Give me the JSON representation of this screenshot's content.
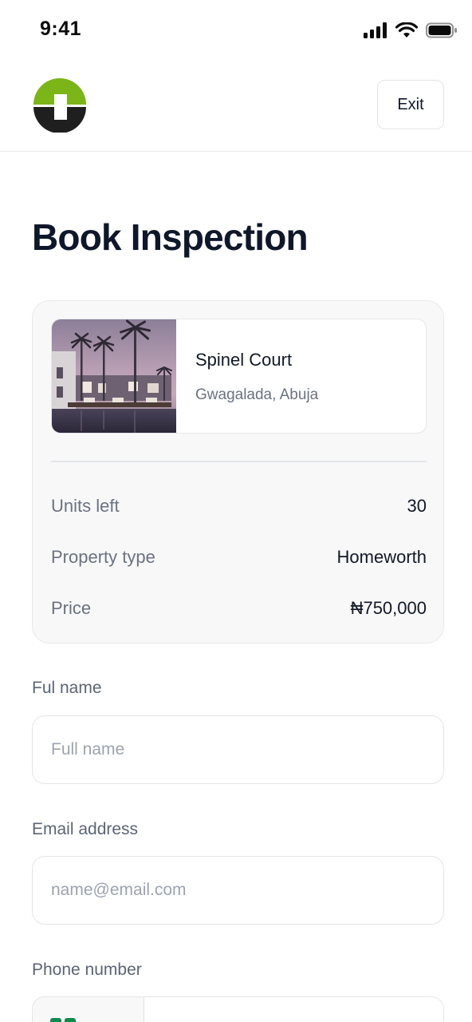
{
  "status_bar": {
    "time": "9:41",
    "icons": [
      "signal-icon",
      "wifi-icon",
      "battery-icon"
    ]
  },
  "header": {
    "logo": "brand-logo",
    "exit_label": "Exit"
  },
  "page": {
    "title": "Book Inspection"
  },
  "property": {
    "name": "Spinel Court",
    "location": "Gwagalada, Abuja"
  },
  "details": [
    {
      "label": "Units left",
      "value": "30"
    },
    {
      "label": "Property type",
      "value": "Homeworth"
    },
    {
      "label": "Price",
      "value": "₦750,000"
    }
  ],
  "form": {
    "full_name": {
      "label": "Ful name",
      "placeholder": "Full name",
      "value": ""
    },
    "email": {
      "label": "Email address",
      "placeholder": "name@email.com",
      "value": ""
    },
    "phone": {
      "label": "Phone number",
      "placeholder": "",
      "value": ""
    }
  },
  "colors": {
    "brand_green": "#7cb518",
    "brand_dark": "#1f1f1f",
    "text_primary": "#111827",
    "text_muted": "#6b7280"
  }
}
